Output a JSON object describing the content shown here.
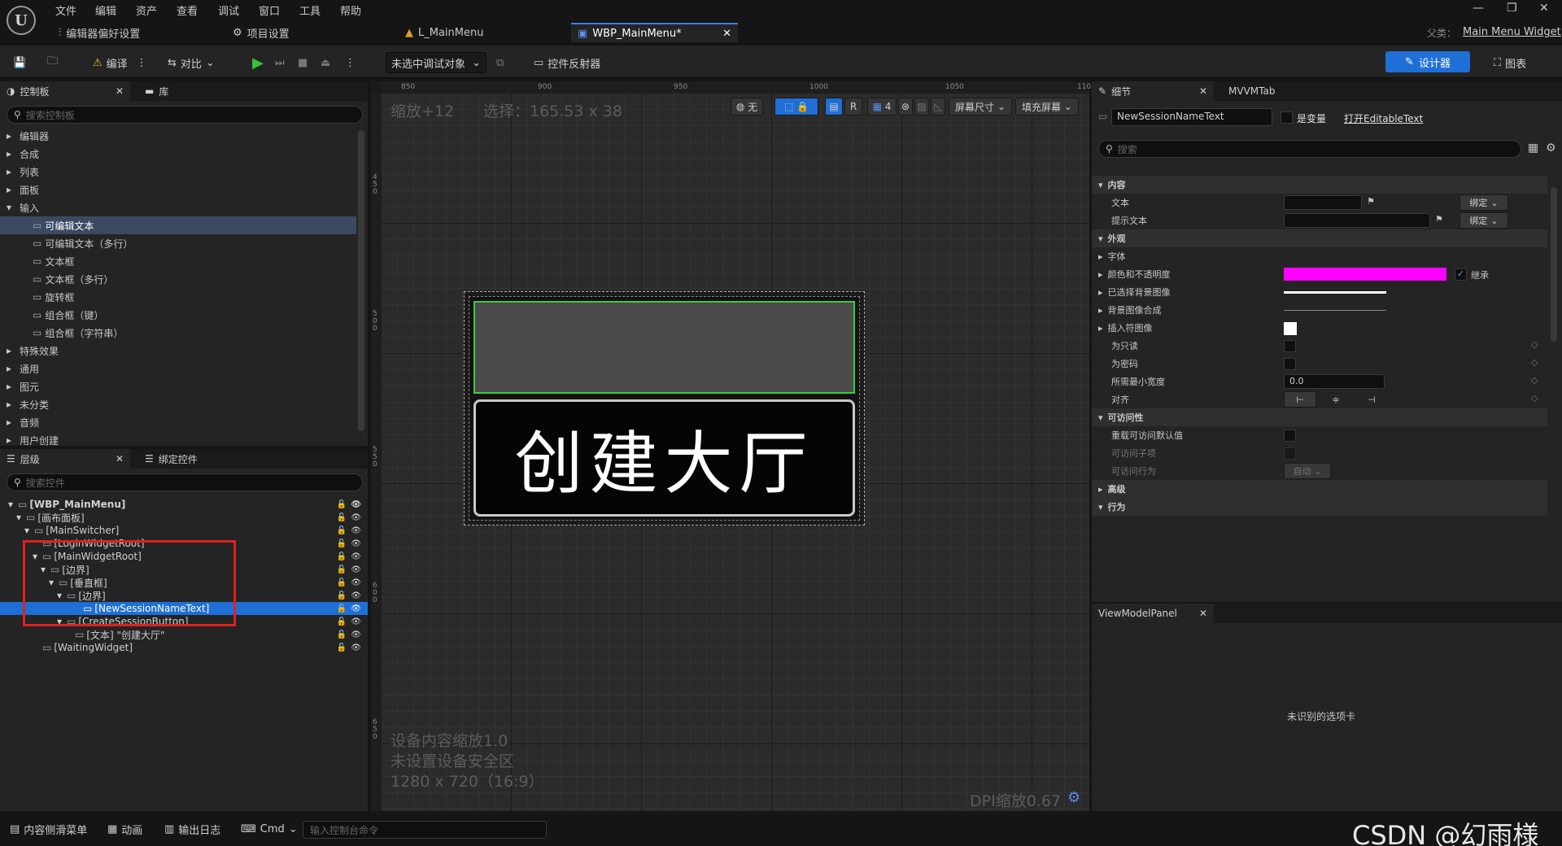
{
  "menu": [
    "文件",
    "编辑",
    "资产",
    "查看",
    "调试",
    "窗口",
    "工具",
    "帮助"
  ],
  "tabs": {
    "editor_prefs": "编辑器偏好设置",
    "project_settings": "项目设置",
    "level": "L_MainMenu",
    "widget": "WBP_MainMenu*"
  },
  "parent": {
    "label": "父类：",
    "value": "Main Menu Widget"
  },
  "toolbar": {
    "compile": "编译",
    "diff": "对比",
    "debug_target": "未选中调试对象",
    "widget_reflector": "控件反射器",
    "designer": "设计器",
    "graph": "图表"
  },
  "palette": {
    "tab_palette": "控制板",
    "tab_library": "库",
    "search_placeholder": "搜索控制板",
    "items": [
      {
        "label": "编辑器",
        "type": "category"
      },
      {
        "label": "合成",
        "type": "category"
      },
      {
        "label": "列表",
        "type": "category"
      },
      {
        "label": "面板",
        "type": "category"
      },
      {
        "label": "输入",
        "type": "category-open"
      },
      {
        "label": "可编辑文本",
        "type": "selected"
      },
      {
        "label": "可编辑文本（多行）",
        "type": "widget"
      },
      {
        "label": "文本框",
        "type": "widget"
      },
      {
        "label": "文本框（多行）",
        "type": "widget"
      },
      {
        "label": "旋转框",
        "type": "widget"
      },
      {
        "label": "组合框（键）",
        "type": "widget"
      },
      {
        "label": "组合框（字符串）",
        "type": "widget"
      },
      {
        "label": "特殊效果",
        "type": "category"
      },
      {
        "label": "通用",
        "type": "category"
      },
      {
        "label": "图元",
        "type": "category"
      },
      {
        "label": "未分类",
        "type": "category"
      },
      {
        "label": "音频",
        "type": "category"
      },
      {
        "label": "用户创建",
        "type": "category"
      }
    ]
  },
  "hierarchy": {
    "tab_hierarchy": "层级",
    "tab_bind": "绑定控件",
    "search_placeholder": "搜索控件",
    "rows": [
      {
        "label": "[WBP_MainMenu]",
        "indent": 0,
        "bold": true
      },
      {
        "label": "[画布面板]",
        "indent": 1
      },
      {
        "label": "[MainSwitcher]",
        "indent": 2
      },
      {
        "label": "[LoginWidgetRoot]",
        "indent": 3
      },
      {
        "label": "[MainWidgetRoot]",
        "indent": 3
      },
      {
        "label": "[边界]",
        "indent": 4
      },
      {
        "label": "[垂直框]",
        "indent": 5
      },
      {
        "label": "[边界]",
        "indent": 6
      },
      {
        "label": "[NewSessionNameText]",
        "indent": 8,
        "selected": true
      },
      {
        "label": "[CreateSessionButton]",
        "indent": 6
      },
      {
        "label": "[文本] \"创建大厅\"",
        "indent": 7
      },
      {
        "label": "[WaitingWidget]",
        "indent": 3
      }
    ]
  },
  "canvas": {
    "zoom": "缩放+12",
    "selection": "选择：165.53 x 38",
    "ruler_top": [
      "850",
      "900",
      "950",
      "1000",
      "1050",
      "110"
    ],
    "ruler_left": [
      "450",
      "500",
      "550",
      "600",
      "650"
    ],
    "toolbar": {
      "none": "无",
      "r": "R",
      "grid": "4",
      "screen_size": "屏幕尺寸",
      "fill_screen": "填充屏幕"
    },
    "button_text": "创建大厅",
    "info": [
      "设备内容缩放1.0",
      "未设置设备安全区",
      "1280 x 720（16:9）"
    ],
    "dpi": "DPI缩放0.67"
  },
  "details": {
    "tab_details": "细节",
    "tab_mvvm": "MVVMTab",
    "widget_name": "NewSessionNameText",
    "is_variable": "是变量",
    "open_link": "打开EditableText",
    "search_placeholder": "搜索",
    "sections": {
      "content": "内容",
      "appearance": "外观",
      "accessibility": "可访问性",
      "advanced": "高级",
      "behavior": "行为"
    },
    "props": {
      "text": "文本",
      "hint_text": "提示文本",
      "bind": "绑定",
      "font": "字体",
      "color_opacity": "颜色和不透明度",
      "inherit": "继承",
      "selected_bg_image": "已选择背景图像",
      "bg_image_composite": "背景图像合成",
      "caret_image": "插入符图像",
      "read_only": "为只读",
      "is_password": "为密码",
      "min_width": "所需最小宽度",
      "min_width_value": "0.0",
      "justify": "对齐",
      "override_access_default": "重载可访问默认值",
      "access_children": "可访问子项",
      "access_behavior": "可访问行为",
      "auto": "自动"
    },
    "color_swatch": "#ff00ff"
  },
  "viewmodel": {
    "tab": "ViewModelPanel",
    "message": "未识别的选项卡"
  },
  "statusbar": {
    "content_drawer": "内容侧滑菜单",
    "animation": "动画",
    "output_log": "输出日志",
    "cmd": "Cmd",
    "console_placeholder": "输入控制台命令",
    "watermark": "CSDN @幻雨様"
  }
}
